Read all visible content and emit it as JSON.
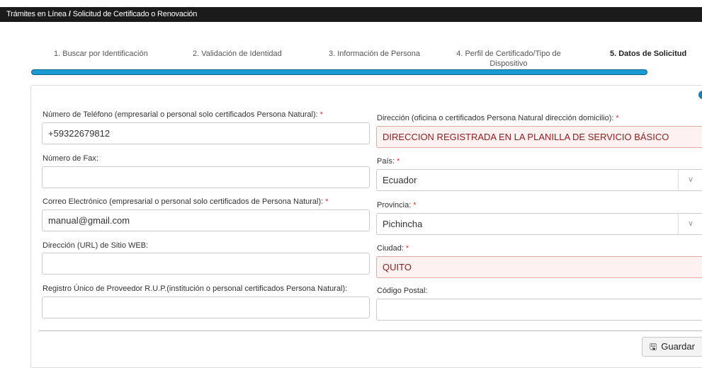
{
  "breadcrumb": {
    "part1": "Trámites en Línea",
    "separator": "/",
    "part2": "Solicitud de Certificado o Renovación"
  },
  "steps": [
    {
      "label": "1. Buscar por Identificación"
    },
    {
      "label": "2. Validación de Identidad"
    },
    {
      "label": "3. Información de Persona"
    },
    {
      "label": "4. Perfil de Certificado/Tipo de Dispositivo"
    },
    {
      "label": "5. Datos de Solicitud"
    }
  ],
  "form": {
    "phone": {
      "label": "Número de Teléfono (empresarial o personal solo certificados Persona Natural):",
      "required": "*",
      "value": "+59322679812"
    },
    "fax": {
      "label": "Número de Fax:",
      "value": ""
    },
    "email": {
      "label": "Correo Electrónico (empresarial o personal solo certificados de Persona Natural):",
      "required": "*",
      "value": "manual@gmail.com"
    },
    "website": {
      "label": "Dirección (URL) de Sitio WEB:",
      "value": ""
    },
    "rup": {
      "label": "Registro Único de Proveedor R.U.P.(institución o personal certificados Persona Natural):",
      "value": ""
    },
    "address": {
      "label": "Dirección (oficina o certificados Persona Natural dirección domicilio):",
      "required": "*",
      "value": "DIRECCION REGISTRADA EN LA PLANILLA DE SERVICIO BÁSICO"
    },
    "country": {
      "label": "País:",
      "required": "*",
      "value": "Ecuador"
    },
    "province": {
      "label": "Provincia:",
      "required": "*",
      "value": "Pichincha"
    },
    "city": {
      "label": "Ciudad:",
      "required": "*",
      "value": "QUITO"
    },
    "postal": {
      "label": "Código Postal:",
      "value": ""
    }
  },
  "actions": {
    "save_label": "Guardar",
    "save_icon": "floppy-disk-icon"
  },
  "colors": {
    "progress": "#1a9bd6",
    "error_bg": "#fdf1f1",
    "required": "#d9342b"
  }
}
